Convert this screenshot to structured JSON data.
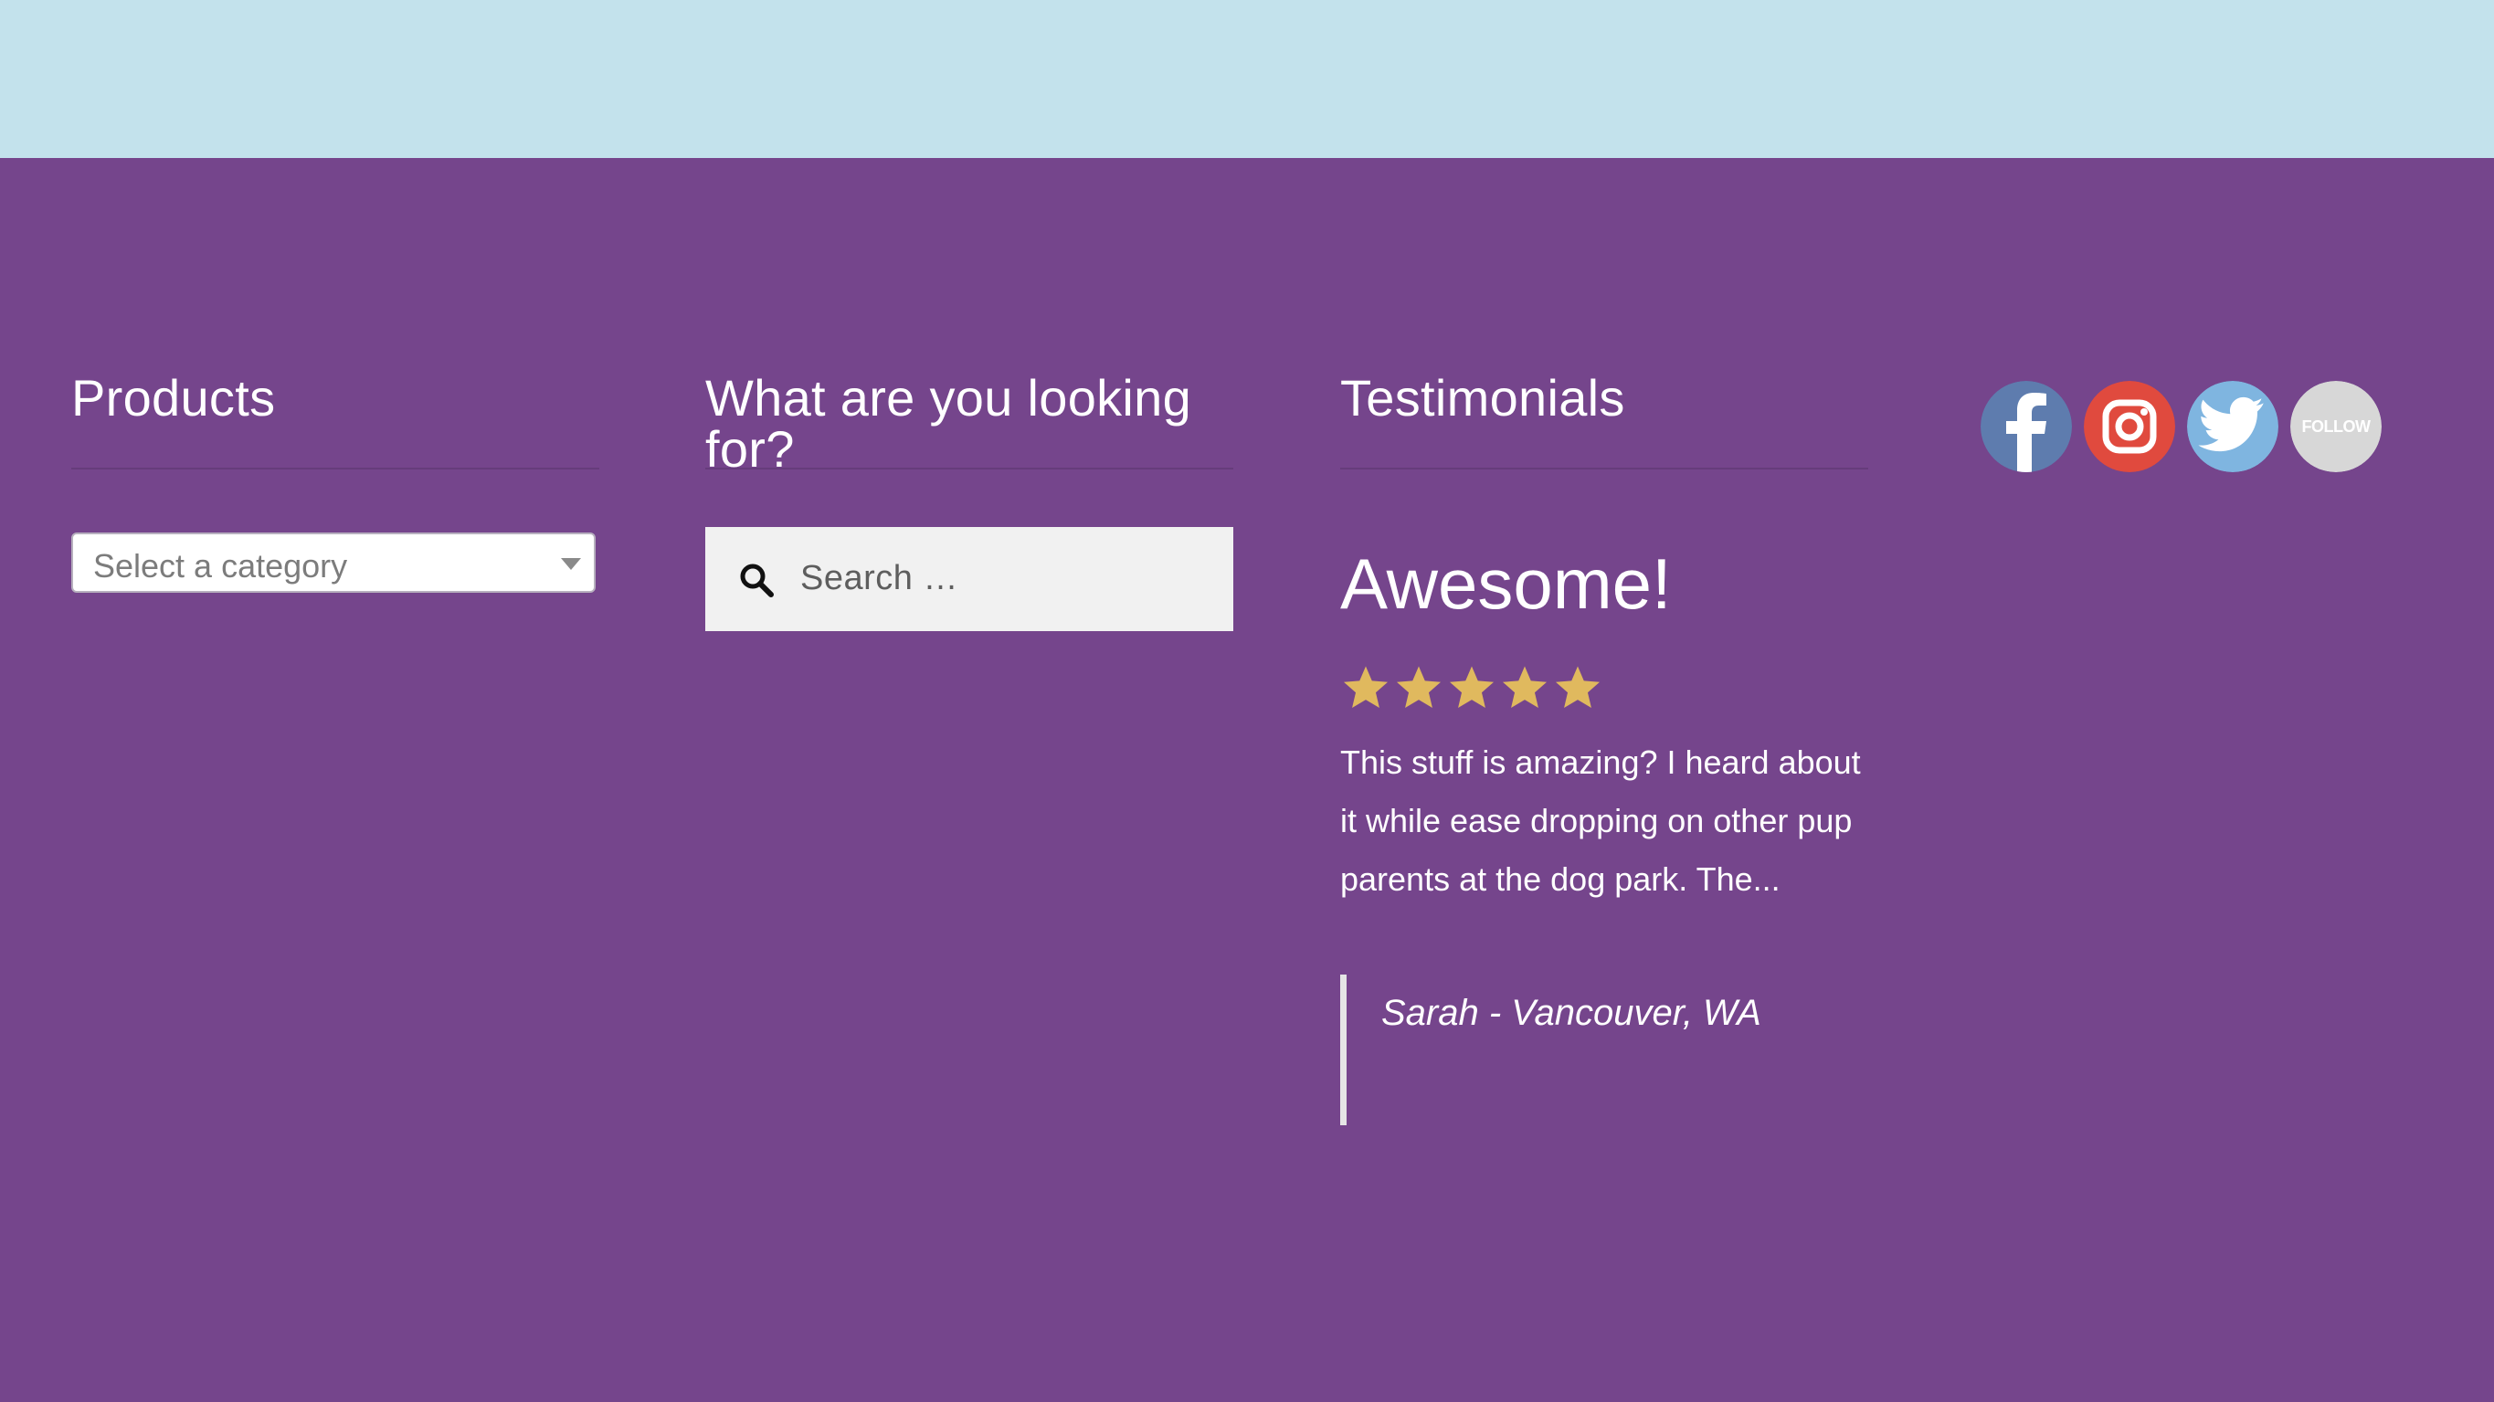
{
  "colors": {
    "top_band": "#c3e2ec",
    "footer_bg": "#75458c",
    "star": "#e0b95e",
    "facebook": "#5e7cae",
    "instagram": "#e04a3e",
    "twitter": "#7fb5e0",
    "follow": "#d7d7d7"
  },
  "products": {
    "title": "Products",
    "select_placeholder": "Select a category"
  },
  "search": {
    "title": "What are you looking for?",
    "placeholder": "Search …"
  },
  "testimonials": {
    "title": "Testimonials",
    "heading": "Awesome!",
    "rating": 5,
    "rating_max": 5,
    "text": "This stuff is amazing? I heard about it while ease dropping on other pup parents at the dog park. The...",
    "author": "Sarah - Vancouver, WA"
  },
  "social": {
    "items": [
      {
        "name": "facebook",
        "icon": "facebook-icon"
      },
      {
        "name": "instagram",
        "icon": "instagram-icon"
      },
      {
        "name": "twitter",
        "icon": "twitter-icon"
      },
      {
        "name": "follow",
        "icon": "follow-icon",
        "label": "FOLLOW"
      }
    ]
  }
}
